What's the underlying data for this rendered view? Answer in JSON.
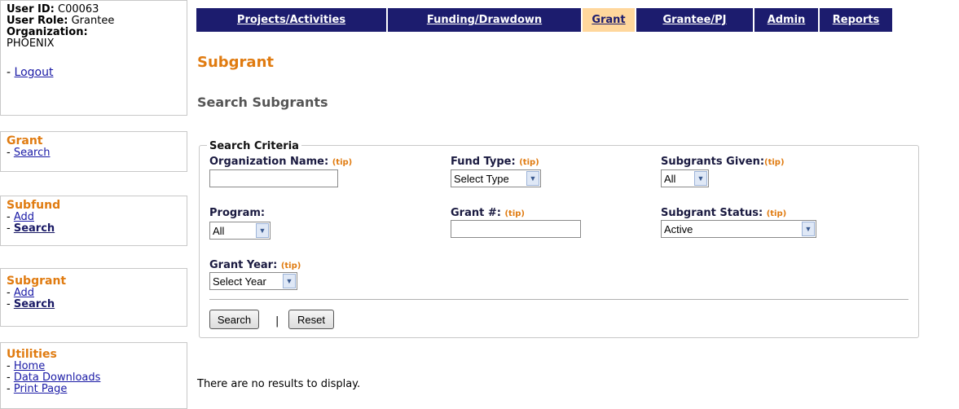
{
  "user": {
    "id_label": "User ID:",
    "id_value": "C00063",
    "role_label": "User Role:",
    "role_value": "Grantee",
    "org_label": "Organization:",
    "org_value": "PHOENIX",
    "logout_prefix": "- ",
    "logout_label": "Logout"
  },
  "sidebar": {
    "grant": {
      "heading": "Grant",
      "items": [
        {
          "prefix": "- ",
          "label": "Search"
        }
      ]
    },
    "subfund": {
      "heading": "Subfund",
      "items": [
        {
          "prefix": "- ",
          "label": "Add"
        },
        {
          "prefix": "- ",
          "label": "Search"
        }
      ]
    },
    "subgrant": {
      "heading": "Subgrant",
      "items": [
        {
          "prefix": "- ",
          "label": "Add"
        },
        {
          "prefix": "- ",
          "label": "Search"
        }
      ]
    },
    "utilities": {
      "heading": "Utilities",
      "items": [
        {
          "prefix": "- ",
          "label": "Home"
        },
        {
          "prefix": "- ",
          "label": "Data Downloads"
        },
        {
          "prefix": "- ",
          "label": "Print Page"
        }
      ]
    }
  },
  "nav": {
    "tabs": [
      "Projects/Activities",
      "Funding/Drawdown",
      "Grant",
      "Grantee/PJ",
      "Admin",
      "Reports"
    ],
    "active": "Grant"
  },
  "page": {
    "title": "Subgrant",
    "subtitle": "Search Subgrants"
  },
  "criteria": {
    "legend": "Search Criteria",
    "tip": "(tip)",
    "org_name_label": "Organization Name:",
    "org_name_value": "",
    "fund_type_label": "Fund Type:",
    "fund_type_value": "Select Type",
    "subgrants_given_label": "Subgrants Given:",
    "subgrants_given_value": "All",
    "program_label": "Program:",
    "program_value": "All",
    "grant_no_label": "Grant #:",
    "grant_no_value": "",
    "status_label": "Subgrant Status:",
    "status_value": "Active",
    "grant_year_label": "Grant Year:",
    "grant_year_value": "Select Year",
    "search_button": "Search",
    "separator": "|",
    "reset_button": "Reset"
  },
  "results": {
    "message": "There are no results to display."
  },
  "colors": {
    "nav_bg": "#1c1c6e",
    "nav_active": "#ffd79c",
    "accent": "#e07b10"
  }
}
